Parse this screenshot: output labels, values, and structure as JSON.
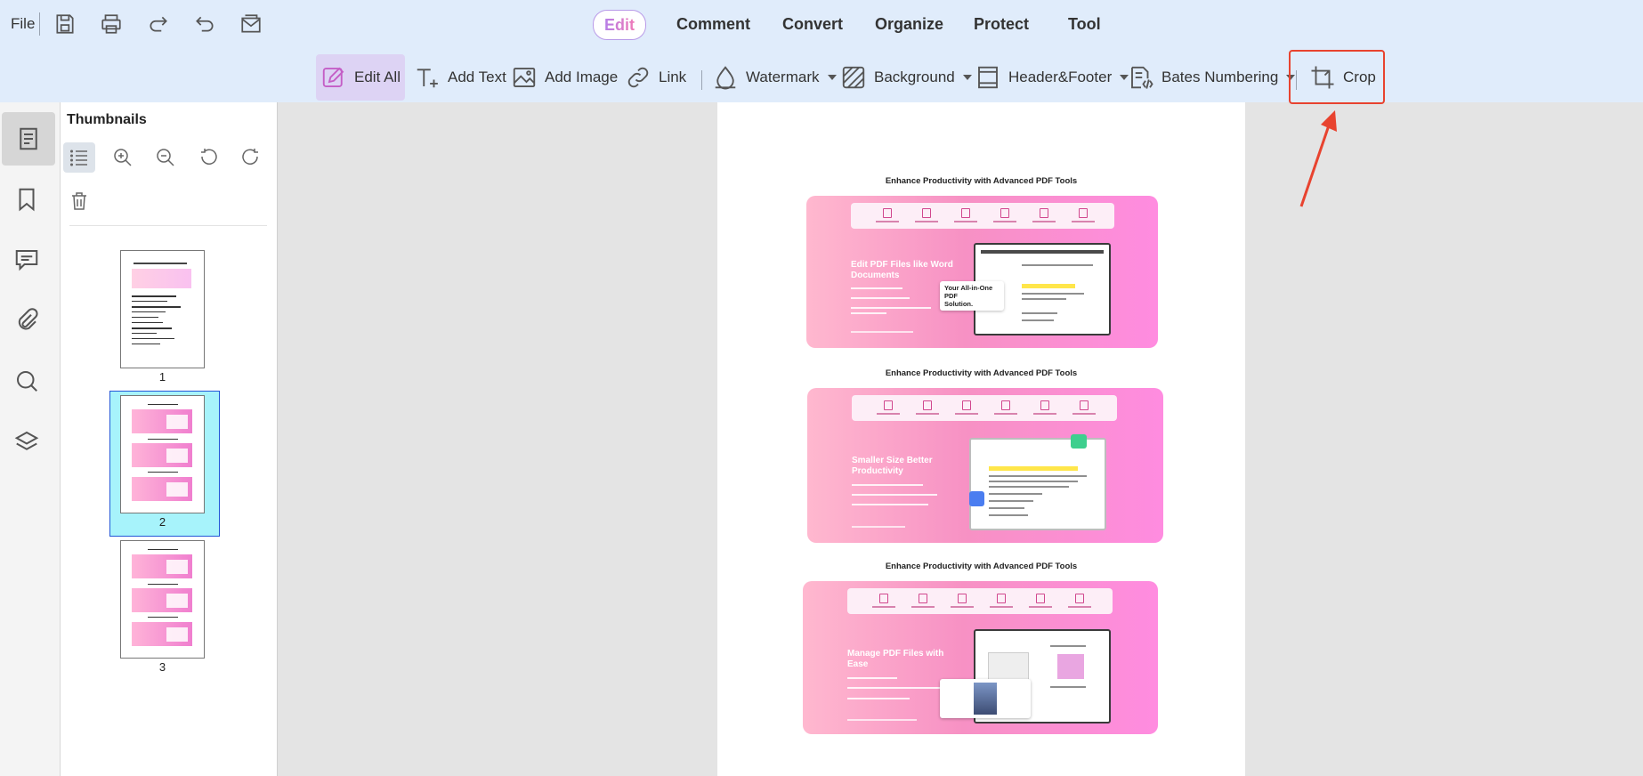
{
  "topbar": {
    "file_label": "File",
    "quick_icons": [
      "save-icon",
      "print-icon",
      "redo-icon",
      "undo-icon",
      "mail-icon"
    ],
    "menu": {
      "edit": "Edit",
      "comment": "Comment",
      "convert": "Convert",
      "organize": "Organize",
      "protect": "Protect",
      "tool": "Tool"
    },
    "tools": {
      "edit_all": "Edit All",
      "add_text": "Add Text",
      "add_image": "Add Image",
      "link": "Link",
      "watermark": "Watermark",
      "background": "Background",
      "header_footer": "Header&Footer",
      "bates_numbering": "Bates Numbering",
      "crop": "Crop"
    },
    "annotation_color": "#e8432f"
  },
  "sidebar_rail": [
    "pages-icon",
    "bookmark-icon",
    "comment-icon",
    "attachment-icon",
    "search-icon",
    "layers-icon"
  ],
  "thumbnails": {
    "title": "Thumbnails",
    "toolbar_icons": [
      "list-view-icon",
      "zoom-in-icon",
      "zoom-out-icon",
      "rotate-left-icon",
      "rotate-right-icon",
      "delete-icon"
    ],
    "pages": [
      {
        "number": "1",
        "selected": false
      },
      {
        "number": "2",
        "selected": true
      },
      {
        "number": "3",
        "selected": false
      }
    ]
  },
  "document": {
    "sections": [
      {
        "title": "Enhance Productivity with Advanced PDF Tools",
        "heading_line1": "Edit PDF Files like Word",
        "heading_line2": "Documents",
        "popup_line1": "Your All-in-One PDF",
        "popup_line2": "Solution."
      },
      {
        "title": "Enhance Productivity with Advanced PDF Tools",
        "heading_line1": "Smaller Size Better",
        "heading_line2": "Productivity"
      },
      {
        "title": "Enhance Productivity with Advanced PDF Tools",
        "heading_line1": "Manage PDF Files with",
        "heading_line2": "Ease"
      }
    ]
  }
}
